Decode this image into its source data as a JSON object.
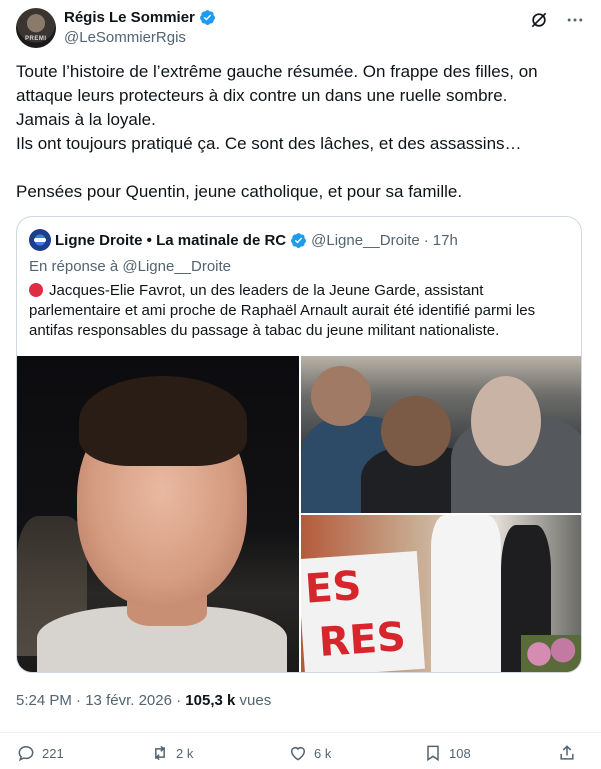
{
  "author": {
    "name": "Régis Le Sommier",
    "handle": "@LeSommierRgis",
    "avatar_text": "PREMI"
  },
  "tweet": {
    "lines": [
      "Toute l’histoire de l’extrême gauche résumée. On frappe des filles, on attaque leurs protecteurs à dix contre un dans une ruelle sombre.",
      "Jamais à la loyale.",
      "Ils ont toujours pratiqué ça. Ce sont des lâches, et des assassins…",
      "",
      "Pensées pour Quentin, jeune catholique, et pour sa famille."
    ]
  },
  "quote": {
    "name": "Ligne Droite • La matinale de RC",
    "handle": "@Ligne__Droite",
    "separator": "·",
    "time": "17h",
    "reply_to": "En réponse à @Ligne__Droite",
    "text": "Jacques-Elie Favrot, un des leaders de la Jeune Garde, assistant parlementaire et ami proche de Raphaël Arnault aurait été identifié parmi les antifas responsables du passage à tabac du jeune militant nationaliste."
  },
  "media": {
    "banner_text_1": "ES",
    "banner_text_2": "RES"
  },
  "meta": {
    "time": "5:24 PM",
    "dot": "·",
    "date": "13 févr. 2026",
    "views_count": "105,3 k",
    "views_label": "vues"
  },
  "actions": {
    "replies": "221",
    "reposts": "2 k",
    "likes": "6 k",
    "bookmarks": "108"
  },
  "colors": {
    "verified": "#1d9bf0",
    "secondary_text": "#536471",
    "border": "#cfd9de",
    "red_dot": "#dd2e44"
  }
}
